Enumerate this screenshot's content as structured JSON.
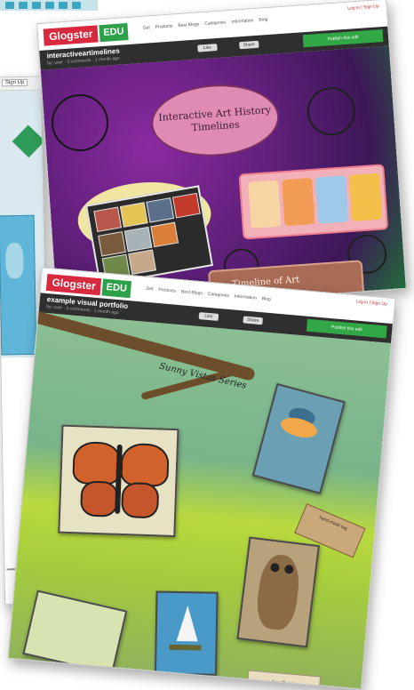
{
  "top_glog": {
    "logo_brand": "Glogster",
    "logo_edu": "EDU",
    "nav": [
      "Get",
      "Products",
      "Best Blogs",
      "Categories",
      "Information",
      "Blog"
    ],
    "auth": "Log in  |  Sign Up",
    "title": "interactiveartimelines",
    "meta": "by: user · 3 comments · 1 month ago",
    "like_label": "Like",
    "share_label": "Share",
    "publish_label": "Publish this edit",
    "canvas_title": "Interactive Art History Timelines",
    "bottom_panel_label": "Timeline of Art"
  },
  "front_glog": {
    "logo_brand": "Glogster",
    "logo_edu": "EDU",
    "nav": [
      "Get",
      "Products",
      "Best Blogs",
      "Categories",
      "Information",
      "Blog"
    ],
    "auth": "Log in  |  Sign Up",
    "title": "example visual portfolio",
    "meta": "by: user · 3 comments · 1 month ago",
    "like_label": "Like",
    "share_label": "Share",
    "publish_label": "Publish this edit",
    "canvas_title": "Sunny Vistas Series",
    "tag_text": "hand-made tag",
    "banner_text": "Any Sunny"
  },
  "left_window": {
    "signin_label": "Sign Up"
  },
  "colors": {
    "glogster_red": "#d82a3e",
    "edu_green": "#2ea04a",
    "purple_canvas": "#5d1f78",
    "green_canvas": "#8bbf93"
  }
}
